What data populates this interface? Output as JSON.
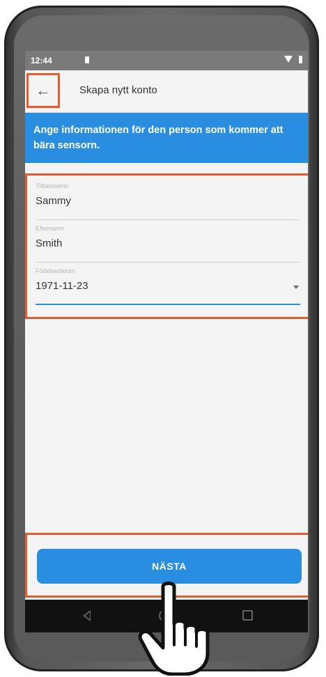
{
  "status_bar": {
    "time": "12:44"
  },
  "app_bar": {
    "title": "Skapa nytt konto",
    "back_icon": "arrow-left-icon"
  },
  "banner": {
    "text": "Ange informationen för den person som kommer att bära sensorn."
  },
  "form": {
    "first_name": {
      "label": "Tilltalsnamn",
      "value": "Sammy"
    },
    "last_name": {
      "label": "Efternamn",
      "value": "Smith"
    },
    "birth_date": {
      "label": "Födelsedatum",
      "value": "1971-11-23"
    }
  },
  "next_button": {
    "label": "NÄSTA"
  },
  "colors": {
    "primary": "#2a8ee0",
    "highlight": "#e65a2e"
  }
}
